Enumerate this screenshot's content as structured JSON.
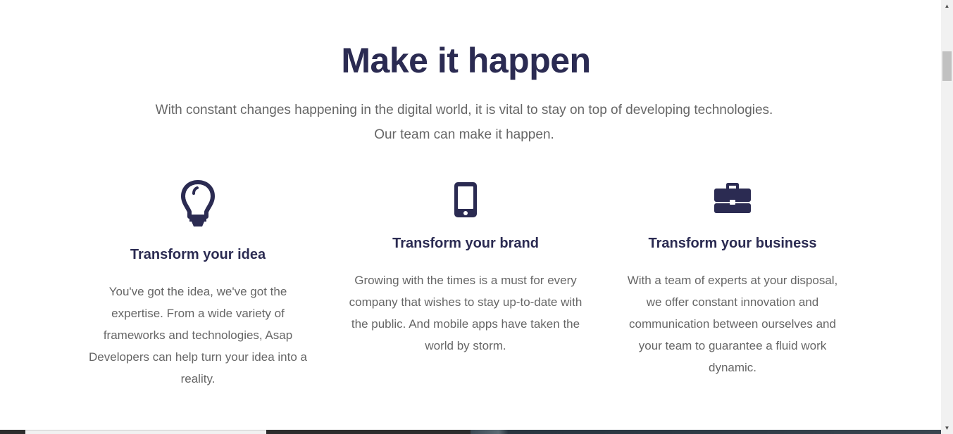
{
  "section": {
    "title": "Make it happen",
    "intro_line1": "With constant changes happening in the digital world, it is vital to stay on top of developing technologies.",
    "intro_line2": "Our team can make it happen."
  },
  "features": [
    {
      "icon": "lightbulb-icon",
      "title": "Transform your idea",
      "text": "You've got the idea, we've got the expertise. From a wide variety of frameworks and technologies, Asap Developers can help turn your idea into a reality."
    },
    {
      "icon": "mobile-phone-icon",
      "title": "Transform your brand",
      "text": "Growing with the times is a must for every company that wishes to stay up-to-date with the public. And mobile apps have taken the world by storm."
    },
    {
      "icon": "briefcase-icon",
      "title": "Transform your business",
      "text": "With a team of experts at your disposal, we offer constant innovation and communication between ourselves and your team to guarantee a fluid work dynamic."
    }
  ],
  "colors": {
    "heading": "#2b2b52",
    "body_text": "#666666",
    "background": "#ffffff"
  }
}
